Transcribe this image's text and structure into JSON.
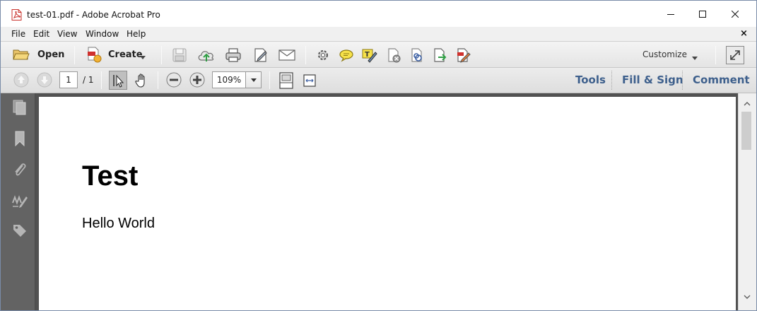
{
  "window": {
    "title": "test-01.pdf - Adobe Acrobat Pro"
  },
  "menu": {
    "items": [
      "File",
      "Edit",
      "View",
      "Window",
      "Help"
    ],
    "close_glyph": "×"
  },
  "toolbar": {
    "open_label": "Open",
    "create_label": "Create",
    "customize_label": "Customize",
    "icons": [
      "open-folder-icon",
      "create-pdf-icon",
      "save-icon",
      "upload-cloud-icon",
      "print-icon",
      "edit-form-icon",
      "email-icon",
      "settings-gear-icon",
      "comment-bubble-icon",
      "highlight-text-icon",
      "redact-icon",
      "link-icon",
      "export-icon",
      "sign-icon",
      "expand-icon"
    ]
  },
  "navigation": {
    "current_page": "1",
    "page_total": "/ 1",
    "zoom": "109%"
  },
  "panels": {
    "tools": "Tools",
    "fill_sign": "Fill & Sign",
    "comment": "Comment"
  },
  "left_pane": {
    "icons": [
      "page-thumbnails-icon",
      "bookmarks-icon",
      "attachments-icon",
      "signatures-icon",
      "tags-icon"
    ]
  },
  "document": {
    "heading": "Test",
    "body": "Hello World"
  },
  "colors": {
    "nav_link": "#3d5f8c",
    "left_pane": "#636363",
    "doc_background": "#515151",
    "pdf_red": "#d0312d"
  }
}
